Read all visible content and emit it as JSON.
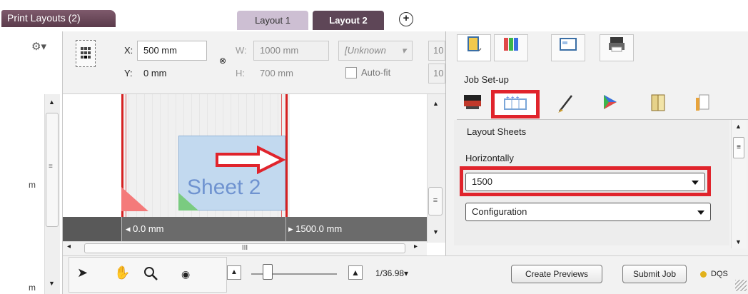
{
  "tabs": {
    "print_layouts": "Print Layouts (2)",
    "layout_1": "Layout 1",
    "layout_2": "Layout 2",
    "add": "+"
  },
  "toolbar": {
    "x_label": "X:",
    "x_value": "500 mm",
    "y_label": "Y:",
    "y_value": "0 mm",
    "w_label": "W:",
    "w_value": "1000 mm",
    "h_label": "H:",
    "h_value": "700 mm",
    "unknown_value": "[Unknown",
    "autofit_label": "Auto-fit",
    "right_clip_1": "10",
    "right_clip_2": "10",
    "link_icon": "link-icon",
    "gear_icon": "gear-icon"
  },
  "canvas": {
    "sheet_label": "Sheet 2",
    "ruler_start": "0.0 mm",
    "ruler_end": "1500.0 mm",
    "left_cut_text": "m",
    "left_cut_text_2": "m"
  },
  "bottom_bar": {
    "zoom_ratio": "1/36.98",
    "create_previews": "Create Previews",
    "submit_job": "Submit Job",
    "dqs": "DQS",
    "tools": [
      "select-arrow-icon",
      "hand-icon",
      "magnifier-icon",
      "eye-icon"
    ]
  },
  "panel": {
    "job_setup": "Job Set-up",
    "layout_sheets": "Layout Sheets",
    "horizontally": "Horizontally",
    "horizontal_value": "1500",
    "configuration_value": "Configuration",
    "top_icons": [
      "document-icon",
      "swatch-icon",
      "window-icon",
      "printer-icon"
    ],
    "job_tabs": [
      "printer-setup-icon",
      "layout-sheets-icon",
      "brush-icon",
      "color-triangle-icon",
      "book-icon",
      "pages-icon"
    ]
  },
  "colors": {
    "highlight_red": "#e0242c",
    "tab_active": "#5e4657",
    "tab_inactive": "#cdbfd3",
    "sheet_blue": "#c2d9ef",
    "dqs_dot": "#e2b21c"
  }
}
